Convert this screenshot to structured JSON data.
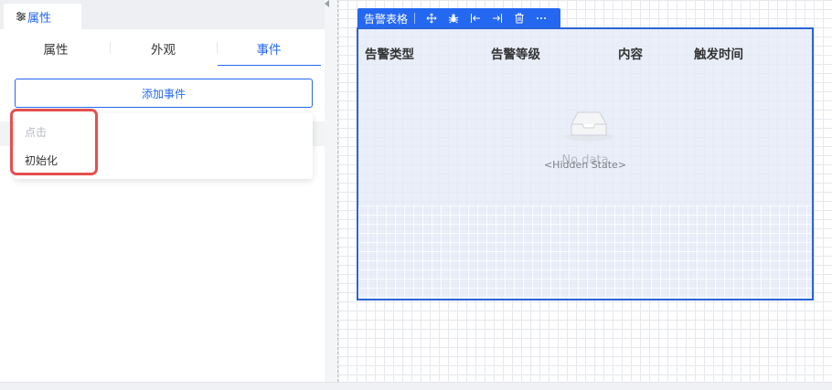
{
  "panel": {
    "tab_label": "属性",
    "sub_tabs": [
      {
        "label": "属性",
        "active": false
      },
      {
        "label": "外观",
        "active": false
      },
      {
        "label": "事件",
        "active": true
      }
    ],
    "add_event_label": "添加事件",
    "event_options": [
      {
        "label": "点击",
        "disabled": true
      },
      {
        "label": "初始化",
        "disabled": false
      }
    ]
  },
  "component": {
    "name": "告警表格",
    "toolbar_icons": [
      "move-icon",
      "bug-icon",
      "align-left-icon",
      "align-right-icon",
      "delete-icon",
      "more-icon"
    ]
  },
  "table": {
    "columns": [
      "告警类型",
      "告警等级",
      "内容",
      "触发时间"
    ],
    "empty_text": "No data",
    "state_label": "<Hidden State>"
  },
  "colors": {
    "accent": "#2468f2",
    "highlight": "#e5504f",
    "selection_border": "#2a64d8"
  }
}
